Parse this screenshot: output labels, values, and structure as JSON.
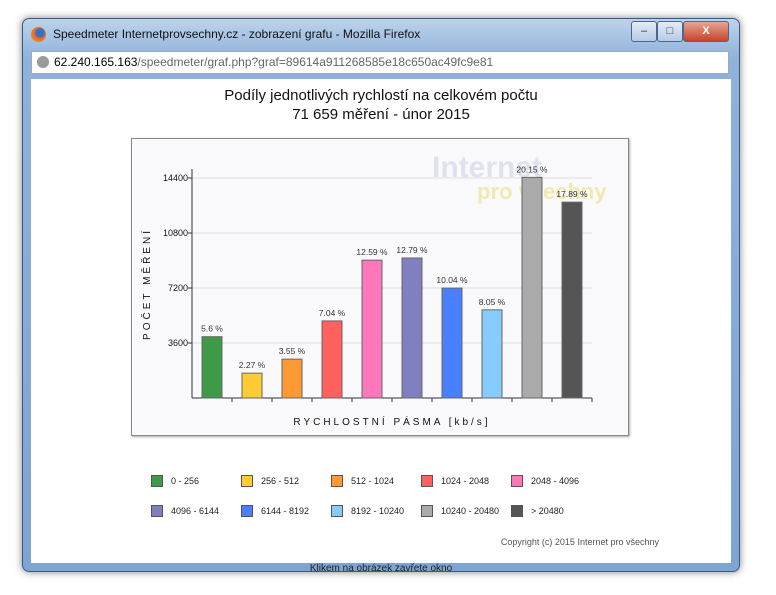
{
  "window": {
    "title": "Speedmeter Internetprovsechny.cz - zobrazení grafu - Mozilla Firefox",
    "url_host": "62.240.165.163",
    "url_path": "/speedmeter/graf.php?graf=89614a911268585e18c650ac49fc9e81",
    "minimize": "–",
    "maximize": "□",
    "close": "X"
  },
  "page": {
    "title1": "Podíly jednotlivých rychlostí na celkovém počtu",
    "title2": "71 659 měření - únor 2015",
    "copyright": "Copyright (c) 2015 Internet pro všechny",
    "close_link": "Klikem na obrázek zavřete okno",
    "watermark": "Internet pro všechny"
  },
  "chart_data": {
    "type": "bar",
    "xlabel": "RYCHLOSTNÍ PÁSMA [kb/s]",
    "ylabel": "POČET MĚŘENÍ",
    "ylim": [
      0,
      16200
    ],
    "yticks": [
      "3600",
      "7200",
      "10800",
      "14400"
    ],
    "categories": [
      "0 - 256",
      "256 - 512",
      "512 - 1024",
      "1024 - 2048",
      "2048 - 4096",
      "4096 - 6144",
      "6144 - 8192",
      "8192 - 10240",
      "10240 - 20480",
      "> 20480"
    ],
    "values": [
      4013,
      1627,
      2544,
      5045,
      9022,
      9165,
      7195,
      5769,
      14439,
      12820
    ],
    "labels": [
      "5.6 %",
      "2.27 %",
      "3.55 %",
      "7.04 %",
      "12.59 %",
      "12.79 %",
      "10.04 %",
      "8.05 %",
      "20.15 %",
      "17.89 %"
    ],
    "colors": [
      "#3e9a46",
      "#ffcc33",
      "#ff9933",
      "#ff6060",
      "#ff77bb",
      "#8080c0",
      "#4a7fff",
      "#88ccff",
      "#aaaaaa",
      "#555555"
    ]
  }
}
